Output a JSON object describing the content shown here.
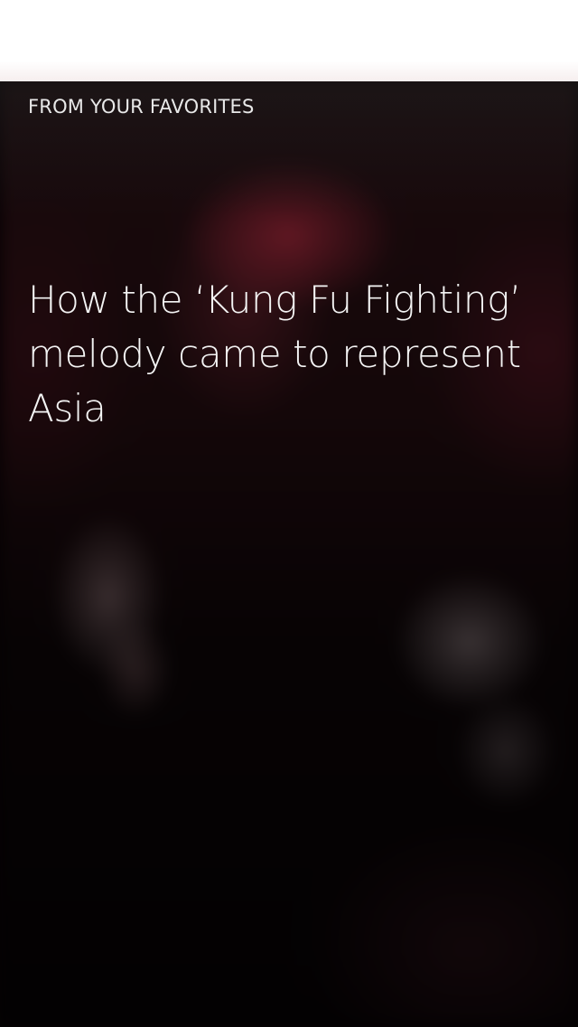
{
  "card": {
    "eyebrow": "FROM YOUR FAVORITES",
    "headline": "How the ‘Kung Fu Fighting’ melody came to represent Asia"
  }
}
